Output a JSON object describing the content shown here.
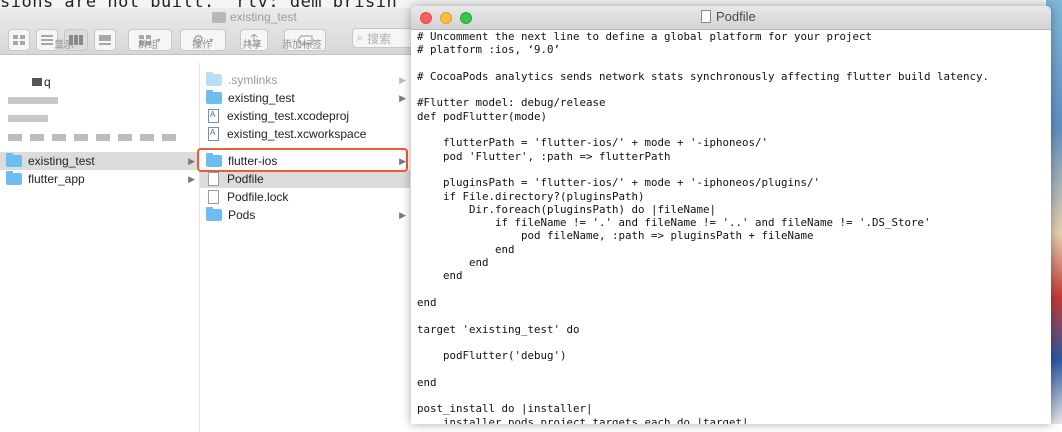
{
  "background": {
    "text": "sions are not built.  rlv: dem brisin"
  },
  "finder": {
    "title": "existing_test",
    "toolbar": {
      "display_label": "显示",
      "group_label": "群组",
      "action_label": "操作",
      "share_label": "共享",
      "add_tag_label": "添加标签",
      "search_placeholder": "搜索"
    },
    "sidebar_items": [
      {
        "label": "q"
      },
      {
        "label": "existing_test",
        "selected": true
      },
      {
        "label": "flutter_app"
      }
    ],
    "contents": [
      {
        "label": ".symlinks",
        "type": "folder-faded"
      },
      {
        "label": "existing_test",
        "type": "folder"
      },
      {
        "label": "existing_test.xcodeproj",
        "type": "xcodeproj"
      },
      {
        "label": "existing_test.xcworkspace",
        "type": "xcworkspace"
      },
      {
        "label": "flutter-ios",
        "type": "folder",
        "highlighted": true
      },
      {
        "label": "Podfile",
        "type": "file",
        "selected": true
      },
      {
        "label": "Podfile.lock",
        "type": "file"
      },
      {
        "label": "Pods",
        "type": "folder"
      }
    ]
  },
  "editor": {
    "title": "Podfile",
    "lines": [
      "# Uncomment the next line to define a global platform for your project",
      "# platform :ios, ‘9.0’",
      "",
      "# CocoaPods analytics sends network stats synchronously affecting flutter build latency.",
      "",
      "#Flutter model: debug/release",
      "def podFlutter(mode)",
      "",
      "    flutterPath = 'flutter-ios/' + mode + '-iphoneos/'",
      "    pod 'Flutter', :path => flutterPath",
      "",
      "    pluginsPath = 'flutter-ios/' + mode + '-iphoneos/plugins/'",
      "    if File.directory?(pluginsPath)",
      "        Dir.foreach(pluginsPath) do |fileName|",
      "            if fileName != '.' and fileName != '..' and fileName != '.DS_Store'",
      "                pod fileName, :path => pluginsPath + fileName",
      "            end",
      "        end",
      "    end",
      "",
      "end",
      "",
      "target 'existing_test' do",
      "",
      "    podFlutter('debug')",
      "",
      "end",
      "",
      "post_install do |installer|",
      "    installer.pods_project.targets.each do |target|"
    ]
  },
  "colors": {
    "highlight_border": "#ec5d34",
    "folder_blue": "#6cbdf1",
    "close": "#fc605c",
    "minimize": "#fdbc40",
    "zoom": "#34c84a"
  }
}
